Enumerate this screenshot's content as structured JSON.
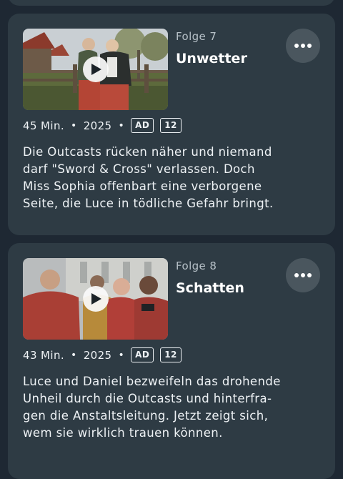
{
  "episodes": [
    {
      "label": "Folge 7",
      "title": "Unwetter",
      "duration": "45 Min.",
      "year": "2025",
      "ad_badge": "AD",
      "age_badge": "12",
      "description_lines": [
        "Die Outcasts rücken näher und niemand",
        "darf \"Sword & Cross\" verlassen. Doch",
        "Miss Sophia offenbart eine verborgene",
        "Seite, die Luce in tödliche Gefahr bringt."
      ]
    },
    {
      "label": "Folge 8",
      "title": "Schatten",
      "duration": "43 Min.",
      "year": "2025",
      "ad_badge": "AD",
      "age_badge": "12",
      "description_lines": [
        "Luce und Daniel bezweifeln das drohende",
        "Unheil durch die Outcasts und hinterfra-",
        "gen die Anstaltsleitung. Jetzt zeigt sich,",
        "wem sie wirklich trauen können."
      ]
    }
  ],
  "meta_separator": "•",
  "icons": {
    "play": "play-icon",
    "more": "more-horizontal-icon"
  },
  "colors": {
    "background": "#1e2833",
    "card": "#2e3b44",
    "more_button": "#4a565e"
  }
}
